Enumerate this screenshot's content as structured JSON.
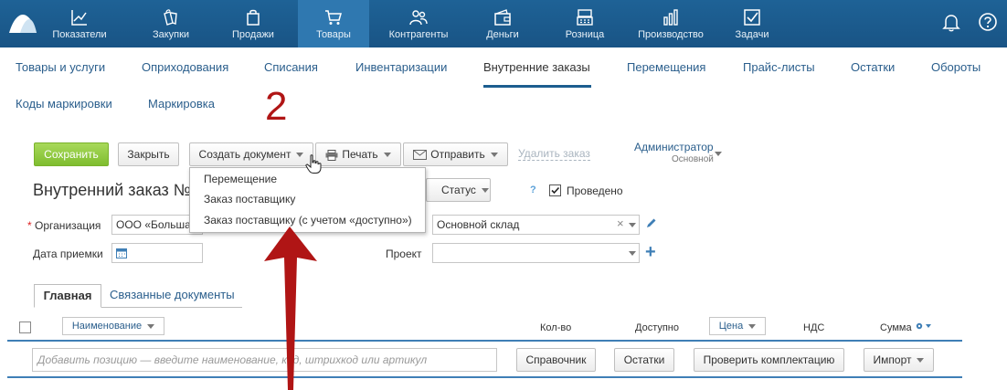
{
  "top_nav": {
    "items": [
      {
        "label": "Показатели",
        "icon": "chart-line-icon"
      },
      {
        "label": "Закупки",
        "icon": "bags-icon"
      },
      {
        "label": "Продажи",
        "icon": "shopping-bag-icon"
      },
      {
        "label": "Товары",
        "icon": "cart-icon"
      },
      {
        "label": "Контрагенты",
        "icon": "people-icon"
      },
      {
        "label": "Деньги",
        "icon": "wallet-icon"
      },
      {
        "label": "Розница",
        "icon": "cash-register-icon"
      },
      {
        "label": "Производство",
        "icon": "bar-chart-icon"
      },
      {
        "label": "Задачи",
        "icon": "checkbox-icon"
      }
    ],
    "active_index": 3,
    "colors": {
      "bar": "#1a5a8a",
      "active": "#2f78b0"
    }
  },
  "sub_nav": {
    "items": [
      "Товары и услуги",
      "Оприходования",
      "Списания",
      "Инвентаризации",
      "Внутренние заказы",
      "Перемещения",
      "Прайс-листы",
      "Остатки",
      "Обороты",
      "Коды маркировки",
      "Маркировка"
    ],
    "active_index": 4
  },
  "annotation": {
    "step_number": "2"
  },
  "toolbar": {
    "save": "Сохранить",
    "close": "Закрыть",
    "create_doc": "Создать документ",
    "print": "Печать",
    "send": "Отправить",
    "delete_order": "Удалить заказ",
    "user_name": "Администратор",
    "user_role": "Основной"
  },
  "create_menu": {
    "items": [
      "Перемещение",
      "Заказ поставщику",
      "Заказ поставщику (с учетом «доступно»)"
    ]
  },
  "form": {
    "title": "Внутренний заказ №",
    "status_label": "Статус",
    "help": "?",
    "posted_label": "Проведено",
    "org_label": "Организация",
    "org_value": "ООО «Больша",
    "warehouse_value": "Основной склад",
    "clear_symbol": "×",
    "accept_date_label": "Дата приемки",
    "project_label": "Проект",
    "plus_symbol": "+"
  },
  "tabs": {
    "main": "Главная",
    "related": "Связанные документы"
  },
  "table": {
    "name_col": "Наименование",
    "qty_col": "Кол-во",
    "avail_col": "Доступно",
    "price_col": "Цена",
    "vat_col": "НДС",
    "sum_col": "Сумма",
    "add_placeholder": "Добавить позицию — введите наименование, код, штрихкод или артикул",
    "catalog_btn": "Справочник",
    "stock_btn": "Остатки",
    "check_btn": "Проверить комплектацию",
    "import_btn": "Импорт"
  }
}
